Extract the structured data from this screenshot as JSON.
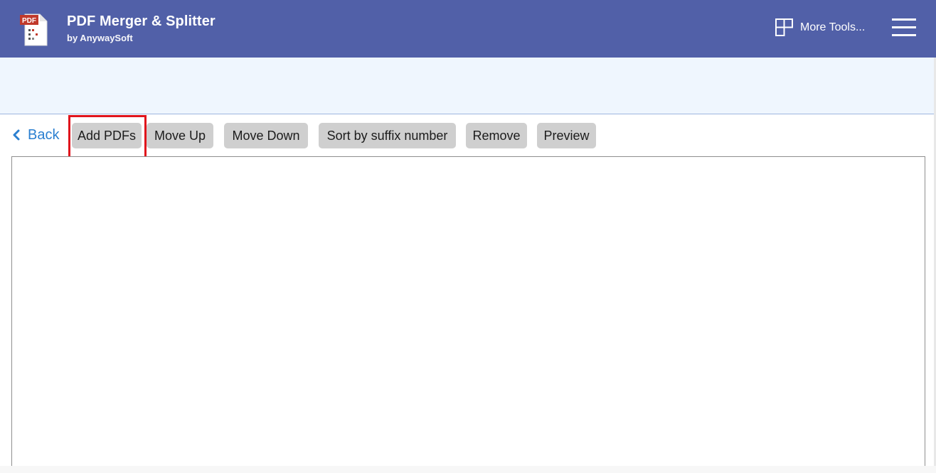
{
  "header": {
    "title": "PDF Merger & Splitter",
    "subtitle": "by AnywaySoft",
    "app_icon": "pdf-file-icon",
    "icon_badge": "PDF",
    "more_tools_label": "More Tools...",
    "more_tools_icon": "grid-icon",
    "menu_icon": "hamburger-icon"
  },
  "toolbar": {
    "back_label": "Back",
    "back_icon": "chevron-left-icon",
    "buttons": [
      {
        "id": "add-pdfs",
        "label": "Add PDFs"
      },
      {
        "id": "move-up",
        "label": "Move Up"
      },
      {
        "id": "move-down",
        "label": "Move Down"
      },
      {
        "id": "sort-suffix",
        "label": "Sort by suffix number"
      },
      {
        "id": "remove",
        "label": "Remove"
      },
      {
        "id": "preview",
        "label": "Preview"
      }
    ]
  },
  "file_list": {
    "items": []
  },
  "colors": {
    "header_bg": "#5160a8",
    "band_bg": "#eff6fe",
    "link_blue": "#2a7fd0",
    "button_bg": "#cfcfcf",
    "highlight_red": "#e0141c"
  }
}
